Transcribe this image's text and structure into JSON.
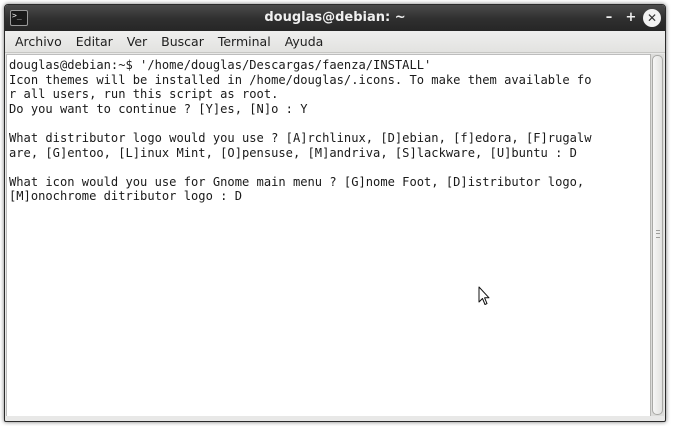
{
  "window": {
    "title": "douglas@debian: ~",
    "app_icon_glyph": ">_",
    "buttons": {
      "minimize": "–",
      "maximize": "+",
      "close": "✕"
    }
  },
  "menubar": {
    "items": [
      {
        "label": "Archivo"
      },
      {
        "label": "Editar"
      },
      {
        "label": "Ver"
      },
      {
        "label": "Buscar"
      },
      {
        "label": "Terminal"
      },
      {
        "label": "Ayuda"
      }
    ]
  },
  "terminal": {
    "lines": [
      "douglas@debian:~$ '/home/douglas/Descargas/faenza/INSTALL'",
      "Icon themes will be installed in /home/douglas/.icons. To make them available fo",
      "r all users, run this script as root.",
      "Do you want to continue ? [Y]es, [N]o : Y",
      "",
      "What distributor logo would you use ? [A]rchlinux, [D]ebian, [f]edora, [F]rugalw",
      "are, [G]entoo, [L]inux Mint, [O]pensuse, [M]andriva, [S]lackware, [U]buntu : D",
      "",
      "What icon would you use for Gnome main menu ? [G]nome Foot, [D]istributor logo,",
      "[M]onochrome ditributor logo : D"
    ]
  },
  "colors": {
    "titlebar": "#2f2f2f",
    "terminal_bg": "#ffffff",
    "terminal_fg": "#1a1a1a"
  }
}
